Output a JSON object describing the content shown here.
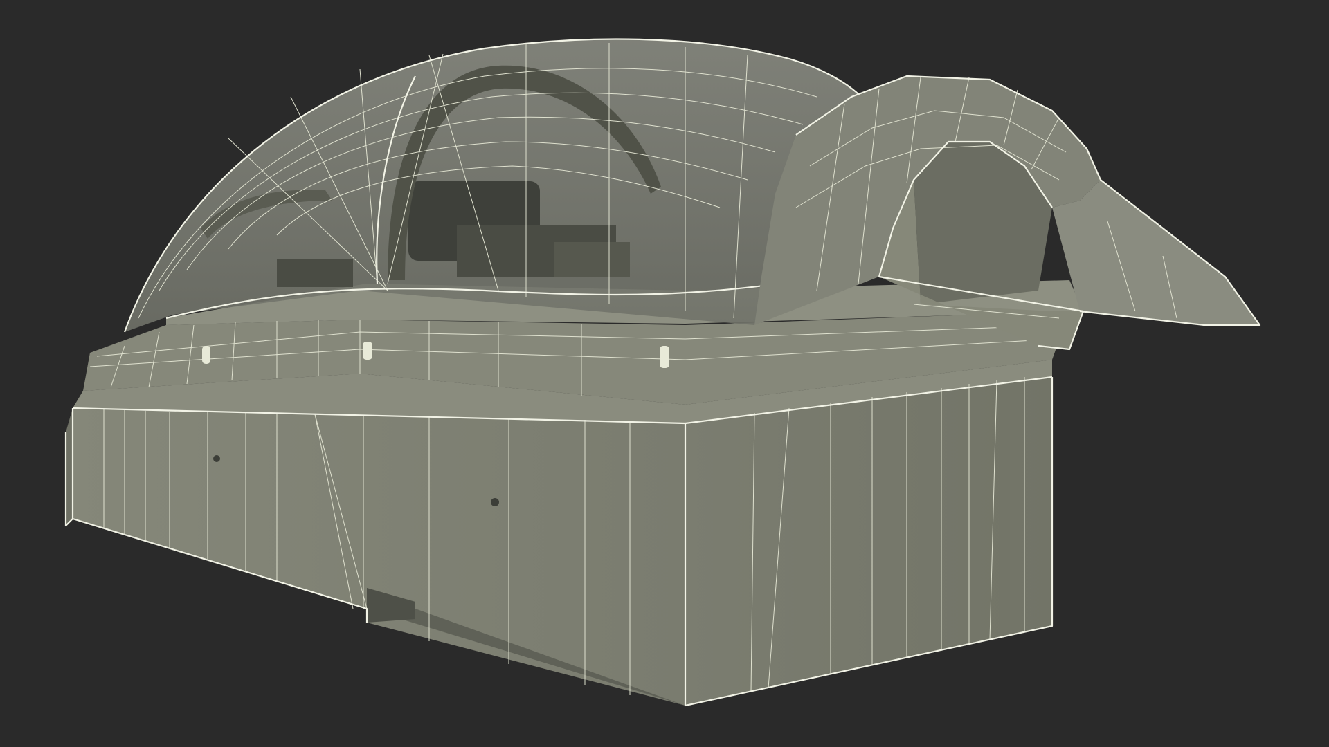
{
  "scene": {
    "subject": "",
    "background_color": "#2a2a2a",
    "surface_color": "#7e8072",
    "surface_dark_color": "#6c6e62",
    "wire_color": "#e8ead8",
    "glass_color": "#9a9c90"
  }
}
